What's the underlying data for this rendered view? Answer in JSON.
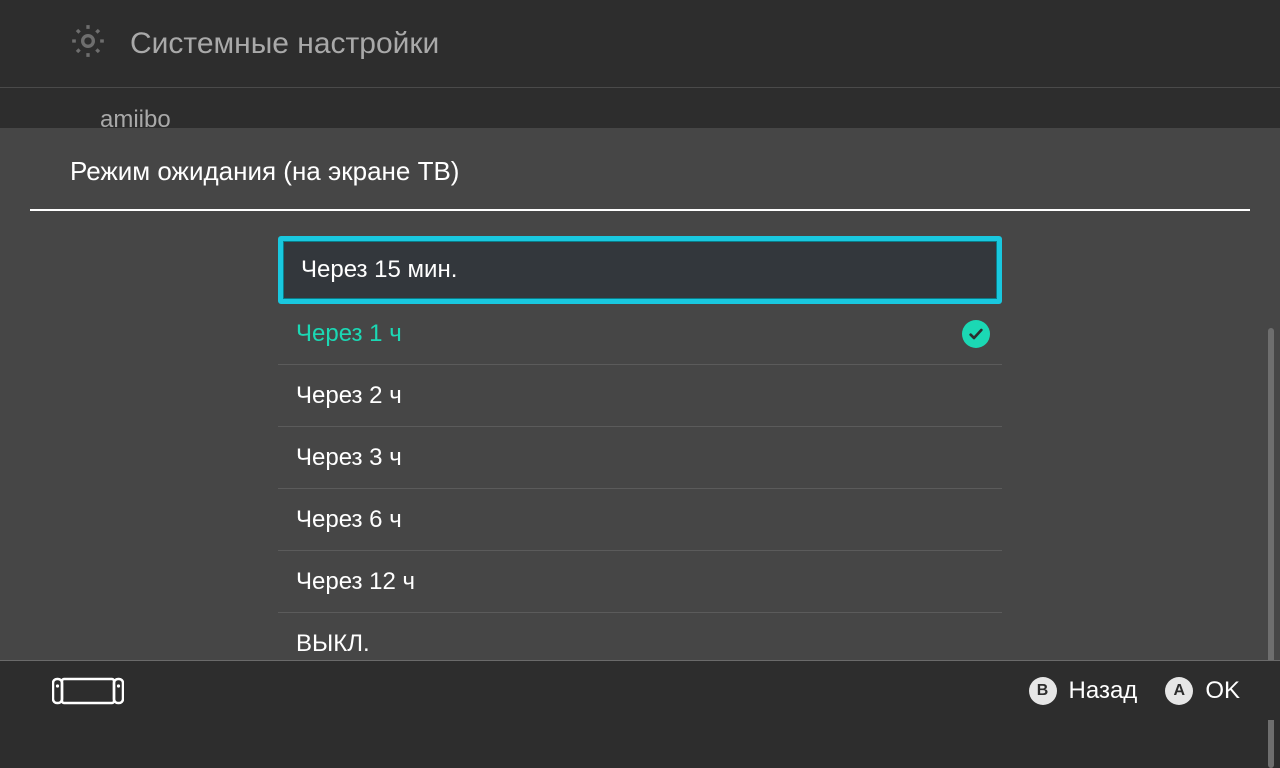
{
  "bg": {
    "title": "Системные настройки",
    "sidebar_item": "amiibo"
  },
  "modal": {
    "title": "Режим ожидания (на экране ТВ)",
    "highlight_index": 0,
    "selected_index": 1,
    "options": [
      "Через 15 мин.",
      "Через 1 ч",
      "Через 2 ч",
      "Через 3 ч",
      "Через 6 ч",
      "Через 12 ч",
      "ВЫКЛ."
    ]
  },
  "footer": {
    "back_glyph": "B",
    "back_label": "Назад",
    "ok_glyph": "A",
    "ok_label": "OK"
  },
  "colors": {
    "accent": "#1bd8b4",
    "cursor": "#19c8df",
    "panel": "#464646",
    "bg": "#2d2d2d"
  }
}
